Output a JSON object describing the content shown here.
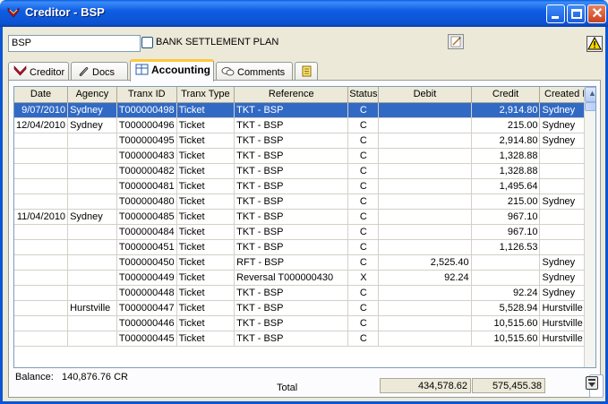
{
  "window": {
    "title": "Creditor - BSP"
  },
  "header": {
    "code_value": "BSP",
    "checkbox_label": "BANK SETTLEMENT PLAN"
  },
  "tabs": [
    {
      "label": "Creditor"
    },
    {
      "label": "Docs"
    },
    {
      "label": "Accounting"
    },
    {
      "label": "Comments"
    }
  ],
  "grid": {
    "columns": [
      "Date",
      "Agency",
      "Tranx ID",
      "Tranx Type",
      "Reference",
      "Status",
      "Debit",
      "Credit",
      "Created In"
    ],
    "rows": [
      {
        "date": "9/07/2010",
        "agency": "Sydney",
        "tranx_id": "T000000498",
        "tranx_type": "Ticket",
        "reference": "TKT - BSP",
        "status": "C",
        "debit": "",
        "credit": "2,914.80",
        "created_in": "Sydney"
      },
      {
        "date": "12/04/2010",
        "agency": "Sydney",
        "tranx_id": "T000000496",
        "tranx_type": "Ticket",
        "reference": "TKT - BSP",
        "status": "C",
        "debit": "",
        "credit": "215.00",
        "created_in": "Sydney"
      },
      {
        "date": "",
        "agency": "",
        "tranx_id": "T000000495",
        "tranx_type": "Ticket",
        "reference": "TKT - BSP",
        "status": "C",
        "debit": "",
        "credit": "2,914.80",
        "created_in": "Sydney"
      },
      {
        "date": "",
        "agency": "",
        "tranx_id": "T000000483",
        "tranx_type": "Ticket",
        "reference": "TKT - BSP",
        "status": "C",
        "debit": "",
        "credit": "1,328.88",
        "created_in": ""
      },
      {
        "date": "",
        "agency": "",
        "tranx_id": "T000000482",
        "tranx_type": "Ticket",
        "reference": "TKT - BSP",
        "status": "C",
        "debit": "",
        "credit": "1,328.88",
        "created_in": ""
      },
      {
        "date": "",
        "agency": "",
        "tranx_id": "T000000481",
        "tranx_type": "Ticket",
        "reference": "TKT - BSP",
        "status": "C",
        "debit": "",
        "credit": "1,495.64",
        "created_in": ""
      },
      {
        "date": "",
        "agency": "",
        "tranx_id": "T000000480",
        "tranx_type": "Ticket",
        "reference": "TKT - BSP",
        "status": "C",
        "debit": "",
        "credit": "215.00",
        "created_in": "Sydney"
      },
      {
        "date": "11/04/2010",
        "agency": "Sydney",
        "tranx_id": "T000000485",
        "tranx_type": "Ticket",
        "reference": "TKT - BSP",
        "status": "C",
        "debit": "",
        "credit": "967.10",
        "created_in": ""
      },
      {
        "date": "",
        "agency": "",
        "tranx_id": "T000000484",
        "tranx_type": "Ticket",
        "reference": "TKT - BSP",
        "status": "C",
        "debit": "",
        "credit": "967.10",
        "created_in": ""
      },
      {
        "date": "",
        "agency": "",
        "tranx_id": "T000000451",
        "tranx_type": "Ticket",
        "reference": "TKT - BSP",
        "status": "C",
        "debit": "",
        "credit": "1,126.53",
        "created_in": ""
      },
      {
        "date": "",
        "agency": "",
        "tranx_id": "T000000450",
        "tranx_type": "Ticket",
        "reference": "RFT - BSP",
        "status": "C",
        "debit": "2,525.40",
        "credit": "",
        "created_in": "Sydney"
      },
      {
        "date": "",
        "agency": "",
        "tranx_id": "T000000449",
        "tranx_type": "Ticket",
        "reference": "Reversal T000000430",
        "status": "X",
        "debit": "92.24",
        "credit": "",
        "created_in": "Sydney"
      },
      {
        "date": "",
        "agency": "",
        "tranx_id": "T000000448",
        "tranx_type": "Ticket",
        "reference": "TKT - BSP",
        "status": "C",
        "debit": "",
        "credit": "92.24",
        "created_in": "Sydney"
      },
      {
        "date": "",
        "agency": "Hurstville",
        "tranx_id": "T000000447",
        "tranx_type": "Ticket",
        "reference": "TKT - BSP",
        "status": "C",
        "debit": "",
        "credit": "5,528.94",
        "created_in": "Hurstville"
      },
      {
        "date": "",
        "agency": "",
        "tranx_id": "T000000446",
        "tranx_type": "Ticket",
        "reference": "TKT - BSP",
        "status": "C",
        "debit": "",
        "credit": "10,515.60",
        "created_in": "Hurstville"
      },
      {
        "date": "",
        "agency": "",
        "tranx_id": "T000000445",
        "tranx_type": "Ticket",
        "reference": "TKT - BSP",
        "status": "C",
        "debit": "",
        "credit": "10,515.60",
        "created_in": "Hurstville"
      }
    ],
    "selected_row": 0
  },
  "totals": {
    "label": "Total",
    "debit": "434,578.62",
    "credit": "575,455.38"
  },
  "footer": {
    "balance_label": "Balance:",
    "balance_value": "140,876.76 CR"
  },
  "icons": {
    "app": "creditor-app-icon",
    "note": "note-icon",
    "warning": "warning-icon",
    "tab_creditor": "creditor-icon",
    "tab_docs": "paperclip-icon",
    "tab_accounting": "accounting-icon",
    "tab_comments": "comments-icon",
    "tab_extra": "notepad-icon"
  },
  "colors": {
    "selection": "#316ac5",
    "titlebar": "#0b52cf",
    "tab_highlight": "#ffc83c",
    "warning": "#ffd700"
  }
}
